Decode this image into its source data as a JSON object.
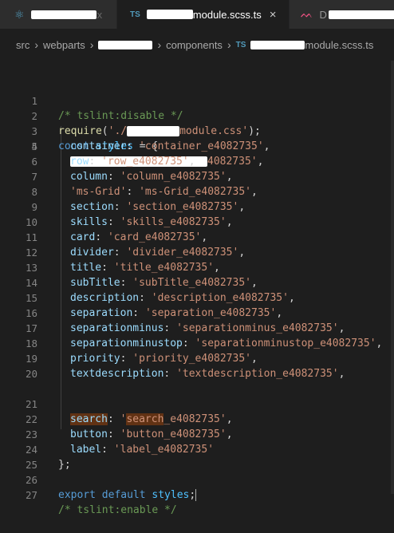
{
  "tabs": [
    {
      "icon": "react-icon",
      "label_suffix": "x",
      "state": "inactive"
    },
    {
      "icon": "ts-badge",
      "badge": "TS",
      "label_suffix": "module.scss.ts",
      "state": "active",
      "close": "×"
    },
    {
      "icon": "scss-icon",
      "label_prefix": "D",
      "state": "inactive"
    }
  ],
  "breadcrumb": {
    "items": [
      "src",
      "webparts",
      "components",
      "module.scss.ts"
    ],
    "separator": "›",
    "ts_badge": "TS"
  },
  "code": {
    "line_numbers": [
      "1",
      "2",
      "3",
      "4",
      "5",
      "6",
      "7",
      "8",
      "9",
      "10",
      "11",
      "12",
      "13",
      "14",
      "15",
      "16",
      "17",
      "18",
      "19",
      "20",
      "21",
      "22",
      "23",
      "24",
      "25",
      "26",
      "27"
    ],
    "l1": "/* tslint:disable */",
    "l2": {
      "fn": "require",
      "open": "(",
      "str_start": "'./",
      "str_end": "module.css'",
      "close": ");"
    },
    "l3": {
      "kw": "const",
      "var": "styles",
      "rest": " = {"
    },
    "l4": {
      "str_end": "4082735'",
      "punc": ","
    },
    "props": [
      {
        "key": "container",
        "val": "'container_e4082735'"
      },
      {
        "key": "row",
        "val": "'row_e4082735'"
      },
      {
        "key": "column",
        "val": "'column_e4082735'"
      },
      {
        "key": "'ms-Grid'",
        "val": "'ms-Grid_e4082735'",
        "key_is_string": true
      },
      {
        "key": "section",
        "val": "'section_e4082735'"
      },
      {
        "key": "skills",
        "val": "'skills_e4082735'"
      },
      {
        "key": "card",
        "val": "'card_e4082735'"
      },
      {
        "key": "divider",
        "val": "'divider_e4082735'"
      },
      {
        "key": "title",
        "val": "'title_e4082735'"
      },
      {
        "key": "subTitle",
        "val": "'subTitle_e4082735'"
      },
      {
        "key": "description",
        "val": "'description_e4082735'"
      },
      {
        "key": "separation",
        "val": "'separation_e4082735'"
      },
      {
        "key": "separationminus",
        "val": "'separationminus_e4082735'"
      },
      {
        "key": "separationminustop",
        "val": "'separationminustop_e4082735'"
      },
      {
        "key": "priority",
        "val": "'priority_e4082735'"
      },
      {
        "key": "textdescription",
        "val": "'textdescription_e4082735'"
      }
    ],
    "l21": {
      "key": "search",
      "q": "'",
      "hl": "search",
      "rest": "_e4082735'",
      "punc": ","
    },
    "l22": {
      "key": "button",
      "val": "'button_e4082735'"
    },
    "l23": {
      "key": "label",
      "val": "'label_e4082735'"
    },
    "l24": "};",
    "l26": {
      "kw": "export default",
      "var": "styles",
      "punc": ";"
    },
    "l27": "/* tslint:enable */"
  },
  "colors": {
    "background": "#1e1e1e",
    "comment": "#6a9955",
    "keyword": "#569cd6",
    "string": "#ce9178",
    "property": "#9cdcfe",
    "function": "#dcdcaa",
    "highlight": "#613214"
  }
}
